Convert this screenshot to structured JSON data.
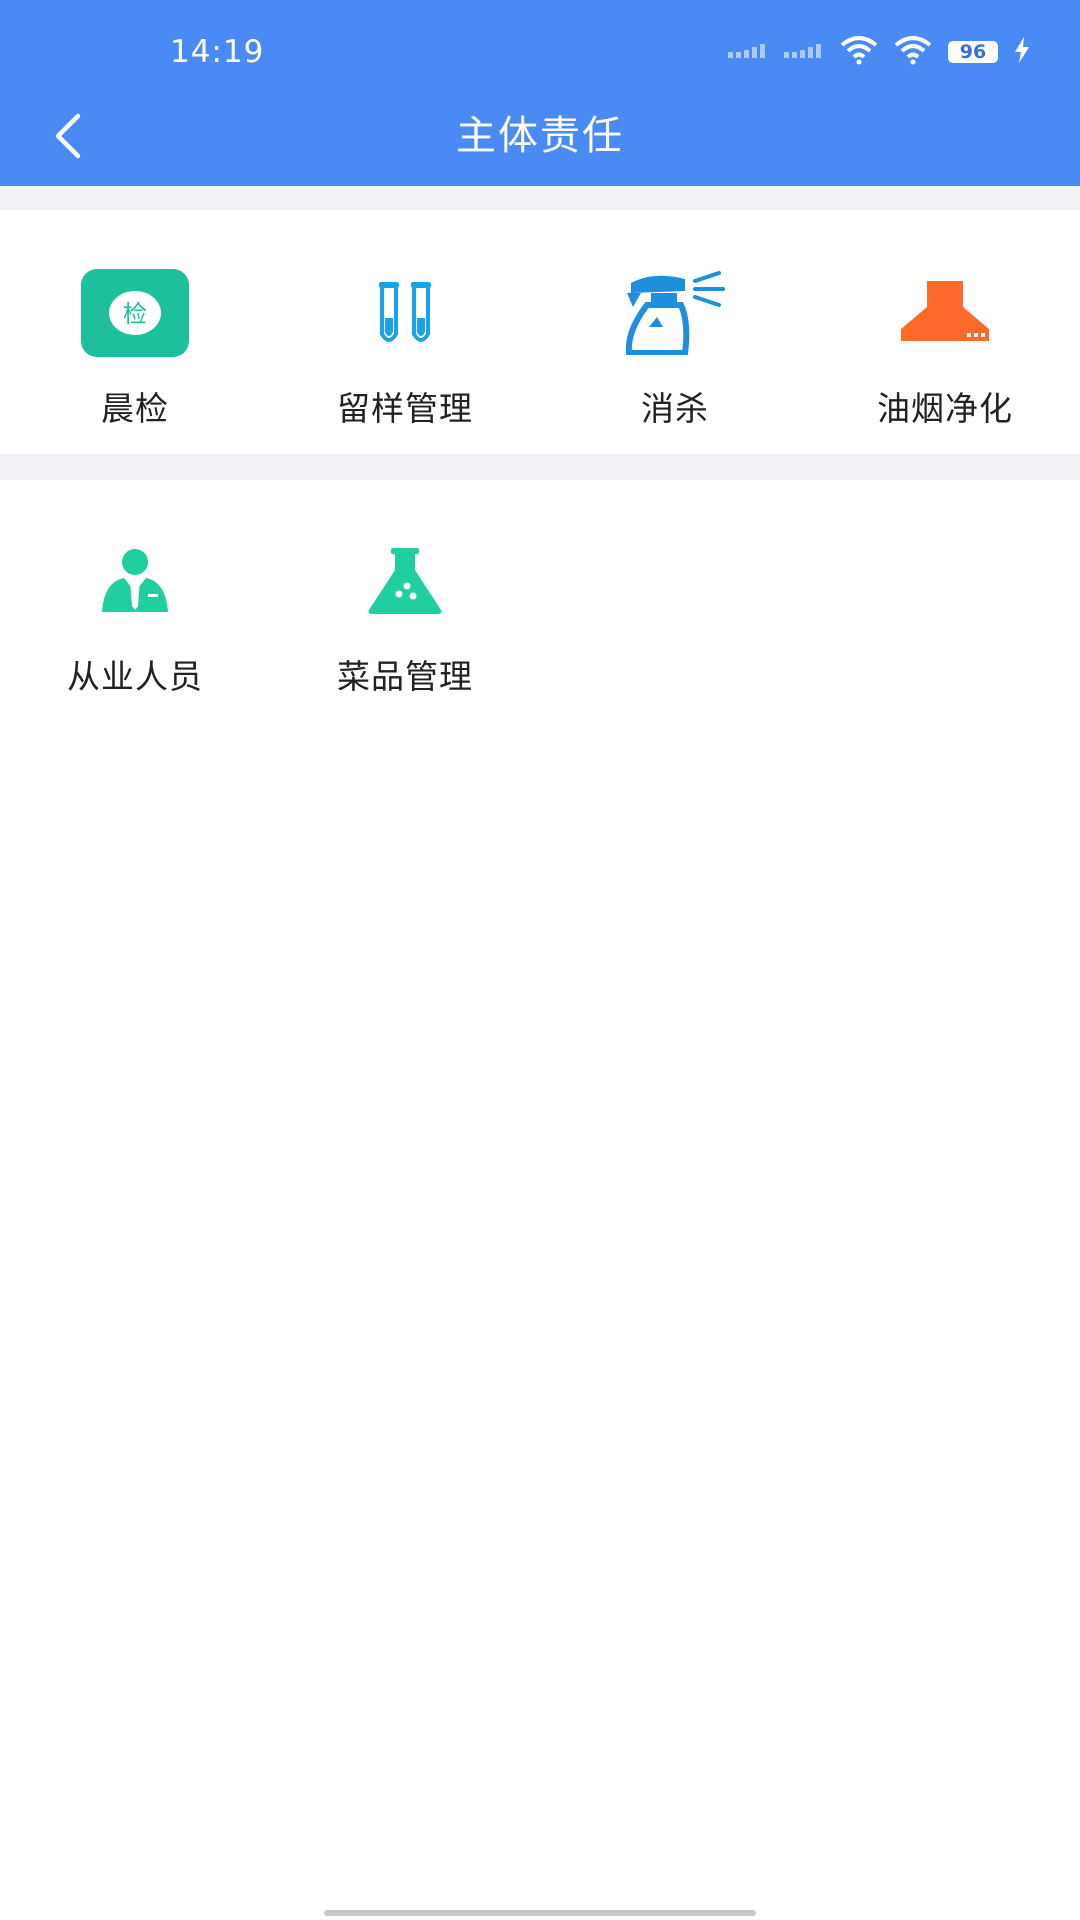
{
  "status_bar": {
    "time": "14:19",
    "battery": "96",
    "icons": [
      "signal-icon",
      "signal-icon",
      "wifi-icon",
      "wifi-icon",
      "battery-icon",
      "charging-icon"
    ]
  },
  "header": {
    "title": "主体责任",
    "back_icon": "back-icon"
  },
  "sections": [
    {
      "items": [
        {
          "label": "晨检",
          "icon": "check-badge-icon",
          "color": "#1dbf9c"
        },
        {
          "label": "留样管理",
          "icon": "test-tube-icon",
          "color": "#1aa3e8"
        },
        {
          "label": "消杀",
          "icon": "spray-bottle-icon",
          "color": "#1d8fdc"
        },
        {
          "label": "油烟净化",
          "icon": "range-hood-icon",
          "color": "#ff6a2b"
        }
      ]
    },
    {
      "items": [
        {
          "label": "从业人员",
          "icon": "staff-icon",
          "color": "#1fcf9f"
        },
        {
          "label": "菜品管理",
          "icon": "flask-icon",
          "color": "#1fcf9f"
        }
      ]
    }
  ],
  "colors": {
    "appbar": "#4a8af4",
    "divider": "#f2f2f6"
  }
}
